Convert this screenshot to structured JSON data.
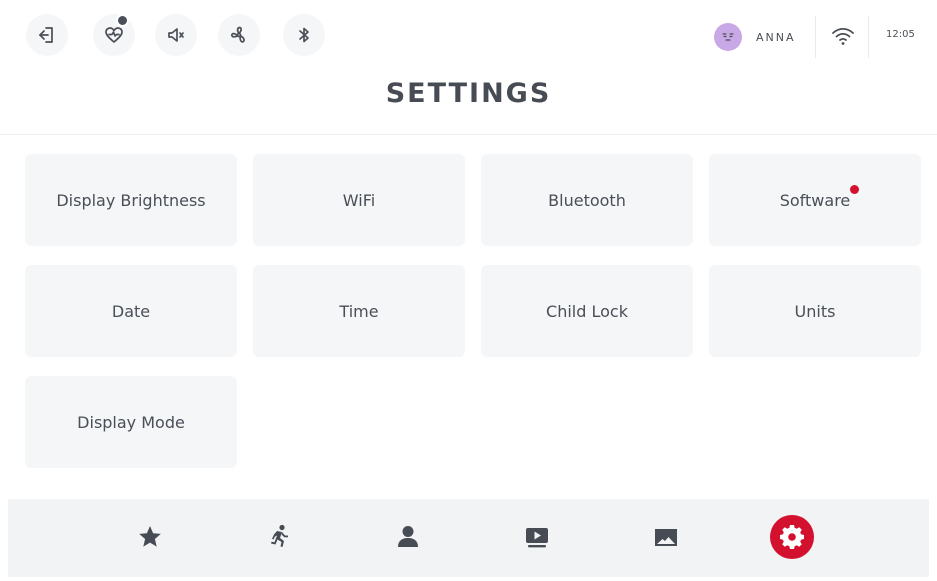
{
  "topbar": {
    "icons": [
      "logout-icon",
      "heart-rate-icon",
      "volume-icon",
      "fan-icon",
      "bluetooth-icon"
    ],
    "user": {
      "name": "ANNA"
    },
    "time": "12:05"
  },
  "page": {
    "title": "SETTINGS"
  },
  "tiles": [
    {
      "label": "Display Brightness"
    },
    {
      "label": "WiFi"
    },
    {
      "label": "Bluetooth"
    },
    {
      "label": "Software"
    },
    {
      "label": "Date"
    },
    {
      "label": "Time"
    },
    {
      "label": "Child Lock"
    },
    {
      "label": "Units"
    },
    {
      "label": "Display Mode"
    }
  ],
  "nav": {
    "items": [
      "favorites-icon",
      "workout-icon",
      "user-icon",
      "video-icon",
      "landscape-icon",
      "settings-icon"
    ],
    "active": "settings-icon"
  },
  "colors": {
    "accent": "#d3102e",
    "tile_bg": "#f4f6f8",
    "text": "#4a4f57",
    "avatar": "#c8a8e6"
  }
}
